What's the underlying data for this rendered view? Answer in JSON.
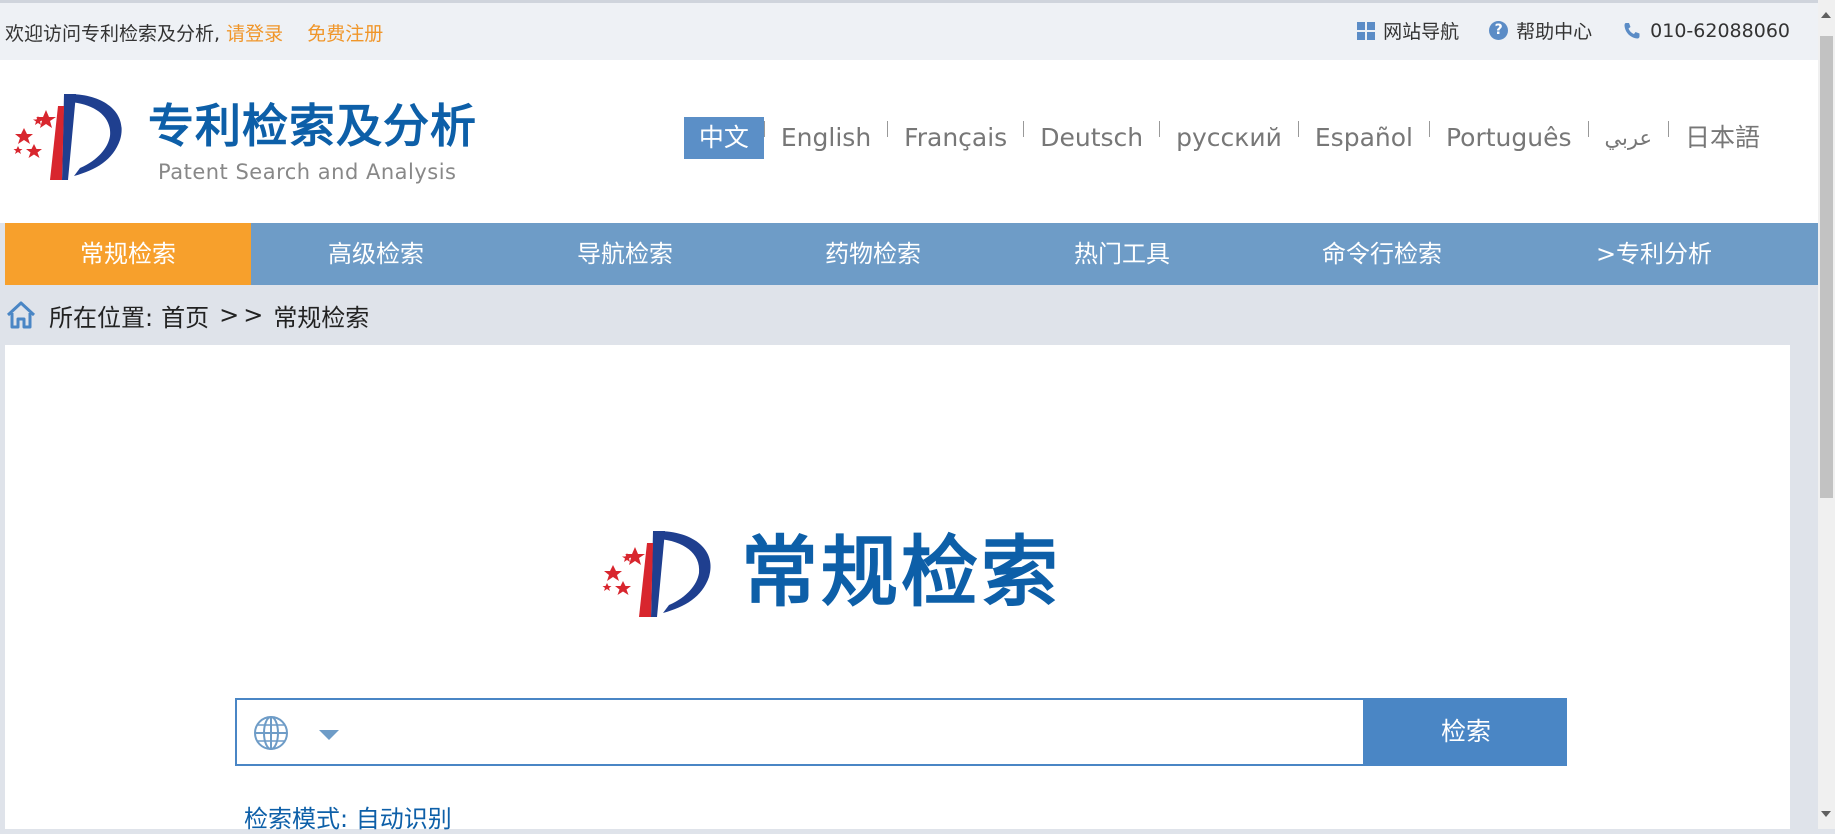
{
  "topbar": {
    "welcome": "欢迎访问专利检索及分析,",
    "login": "请登录",
    "register": "免费注册",
    "site_nav": "网站导航",
    "help": "帮助中心",
    "phone": "010-62088060"
  },
  "header": {
    "title": "专利检索及分析",
    "subtitle": "Patent Search and Analysis",
    "languages": [
      "中文",
      "English",
      "Français",
      "Deutsch",
      "русский",
      "Español",
      "Português",
      "عربي",
      "日本語"
    ]
  },
  "nav": {
    "items": [
      "常规检索",
      "高级检索",
      "导航检索",
      "药物检索",
      "热门工具",
      "命令行检索",
      ">专利分析"
    ]
  },
  "breadcrumb": {
    "prefix": "所在位置:",
    "home": "首页",
    "sep": ">>",
    "current": "常规检索"
  },
  "main": {
    "title": "常规检索",
    "search_button": "检索",
    "search_placeholder": "",
    "mode": "检索模式: 自动识别"
  },
  "colors": {
    "brand_blue": "#0d5fa8",
    "nav_blue": "#6e9cc7",
    "accent_orange": "#f7a02c",
    "button_blue": "#4a86c5"
  }
}
